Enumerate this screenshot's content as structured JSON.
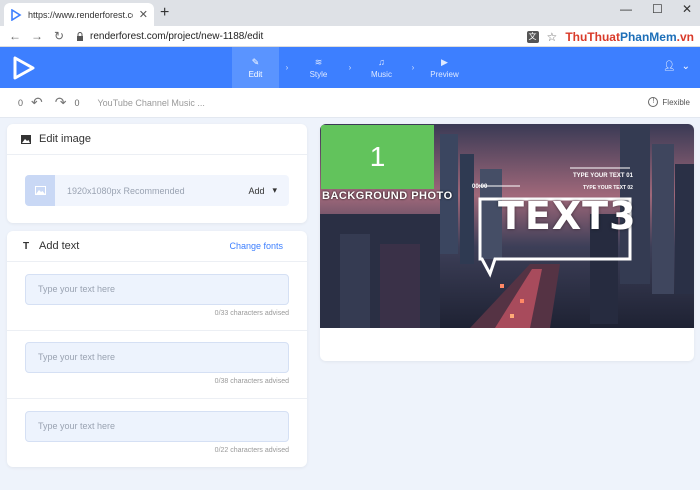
{
  "browser": {
    "tab_title": "https://www.renderforest.com/p...",
    "tab_close": "✕",
    "new_tab": "+",
    "url": "renderforest.com/project/new-1188/edit",
    "brand": {
      "part1": "ThuThuat",
      "part2": "PhanMem",
      "suffix": ".vn"
    }
  },
  "nav": {
    "steps": [
      {
        "label": "Edit",
        "icon": "pencil-icon",
        "active": true
      },
      {
        "label": "Style",
        "icon": "layers-icon",
        "active": false
      },
      {
        "label": "Music",
        "icon": "music-icon",
        "active": false
      },
      {
        "label": "Preview",
        "icon": "play-icon",
        "active": false
      }
    ]
  },
  "undobar": {
    "undo_count": "0",
    "redo_count": "0",
    "project_title": "YouTube Channel Music ...",
    "mode_label": "Flexible"
  },
  "edit_image": {
    "title": "Edit image",
    "recommended": "1920x1080px Recommended",
    "add_label": "Add"
  },
  "add_text": {
    "title": "Add text",
    "change_fonts": "Change fonts",
    "fields": [
      {
        "placeholder": "Type your text here",
        "advise": "0/33 characters advised"
      },
      {
        "placeholder": "Type your text here",
        "advise": "0/38 characters advised"
      },
      {
        "placeholder": "Type your text here",
        "advise": "0/22 characters advised"
      }
    ]
  },
  "preview": {
    "bg_number": "1",
    "bg_label": "BACKGROUND PHOTO",
    "timecode": "00:00",
    "text1": "TYPE YOUR TEXT 01",
    "text2": "TYPE YOUR TEXT 02",
    "text3": "TEXT3"
  },
  "colors": {
    "accent": "#3d7fff",
    "green": "#62c35c"
  }
}
